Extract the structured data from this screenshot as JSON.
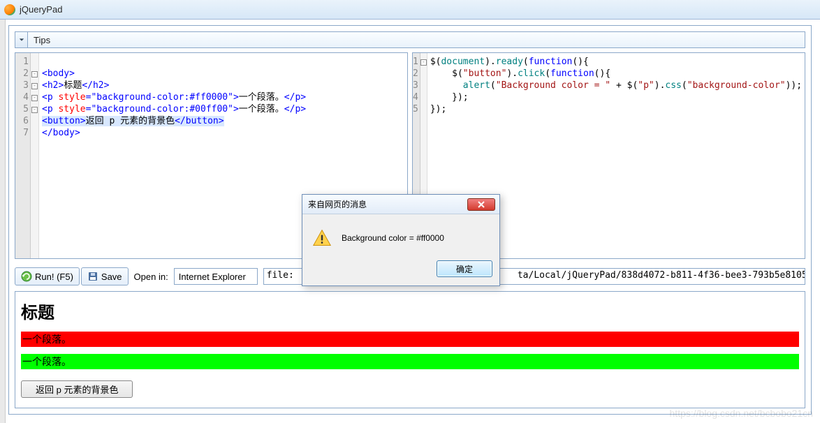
{
  "window": {
    "title": "jQueryPad"
  },
  "tipsbar": {
    "label": "Tips"
  },
  "left_editor": {
    "lines": [
      "1",
      "2",
      "3",
      "4",
      "5",
      "6",
      "7"
    ],
    "fold": [
      "",
      "⊟",
      "⊟",
      "⊟",
      "⊟",
      "",
      ""
    ],
    "code_lines": [
      {
        "segments": []
      },
      {
        "segments": [
          {
            "t": "<body>",
            "c": "tag"
          }
        ]
      },
      {
        "segments": [
          {
            "t": "<h2>",
            "c": "tag"
          },
          {
            "t": "标题",
            "c": "txt"
          },
          {
            "t": "</h2>",
            "c": "tag"
          }
        ]
      },
      {
        "segments": [
          {
            "t": "<p ",
            "c": "tag"
          },
          {
            "t": "style",
            "c": "attr"
          },
          {
            "t": "=",
            "c": "tag"
          },
          {
            "t": "\"background-color:#ff0000\"",
            "c": "str"
          },
          {
            "t": ">",
            "c": "tag"
          },
          {
            "t": "一个段落。",
            "c": "txt"
          },
          {
            "t": "</p>",
            "c": "tag"
          }
        ]
      },
      {
        "segments": [
          {
            "t": "<p ",
            "c": "tag"
          },
          {
            "t": "style",
            "c": "attr"
          },
          {
            "t": "=",
            "c": "tag"
          },
          {
            "t": "\"background-color:#00ff00\"",
            "c": "str"
          },
          {
            "t": ">",
            "c": "tag"
          },
          {
            "t": "一个段落。",
            "c": "txt"
          },
          {
            "t": "</p>",
            "c": "tag"
          }
        ]
      },
      {
        "segments": [
          {
            "t": "<button>",
            "c": "tag"
          },
          {
            "t": "返回 p 元素的背景色",
            "c": "txt"
          },
          {
            "t": "</button>",
            "c": "tag"
          }
        ],
        "hl": true
      },
      {
        "segments": [
          {
            "t": "</body>",
            "c": "tag"
          }
        ]
      }
    ]
  },
  "right_editor": {
    "lines": [
      "1",
      "2",
      "3",
      "4",
      "5"
    ],
    "fold": [
      "⊟",
      "",
      "",
      "",
      ""
    ],
    "code_lines": [
      {
        "segments": [
          {
            "t": "$",
            "c": "pun"
          },
          {
            "t": "(",
            "c": "pun"
          },
          {
            "t": "document",
            "c": "fun"
          },
          {
            "t": ").",
            "c": "pun"
          },
          {
            "t": "ready",
            "c": "fun"
          },
          {
            "t": "(",
            "c": "pun"
          },
          {
            "t": "function",
            "c": "kwd"
          },
          {
            "t": "(){",
            "c": "pun"
          }
        ]
      },
      {
        "segments": [
          {
            "t": "    $",
            "c": "pun"
          },
          {
            "t": "(",
            "c": "pun"
          },
          {
            "t": "\"button\"",
            "c": "lit"
          },
          {
            "t": ").",
            "c": "pun"
          },
          {
            "t": "click",
            "c": "fun"
          },
          {
            "t": "(",
            "c": "pun"
          },
          {
            "t": "function",
            "c": "kwd"
          },
          {
            "t": "(){",
            "c": "pun"
          }
        ]
      },
      {
        "segments": [
          {
            "t": "      alert",
            "c": "fun"
          },
          {
            "t": "(",
            "c": "pun"
          },
          {
            "t": "\"Background color = \"",
            "c": "lit"
          },
          {
            "t": " + $",
            "c": "pun"
          },
          {
            "t": "(",
            "c": "pun"
          },
          {
            "t": "\"p\"",
            "c": "lit"
          },
          {
            "t": ").",
            "c": "pun"
          },
          {
            "t": "css",
            "c": "fun"
          },
          {
            "t": "(",
            "c": "pun"
          },
          {
            "t": "\"background-color\"",
            "c": "lit"
          },
          {
            "t": "));",
            "c": "pun"
          }
        ]
      },
      {
        "segments": [
          {
            "t": "    });",
            "c": "pun"
          }
        ]
      },
      {
        "segments": [
          {
            "t": "});",
            "c": "pun"
          }
        ]
      }
    ]
  },
  "toolbar": {
    "run_label": "Run! (F5)",
    "save_label": "Save",
    "open_in_label": "Open in:",
    "browser_value": "Internet Explorer",
    "path_prefix": "file:",
    "path_suffix": "ta/Local/jQueryPad/838d4072-b811-4f36-bee3-793b5e8105"
  },
  "preview": {
    "h2": "标题",
    "p1": "一个段落。",
    "p2": "一个段落。",
    "button": "返回 p 元素的背景色"
  },
  "dialog": {
    "title": "来自网页的消息",
    "message": "Background color = #ff0000",
    "ok": "确定"
  },
  "watermark": "https://blog.csdn.net/bcbobo21cn"
}
